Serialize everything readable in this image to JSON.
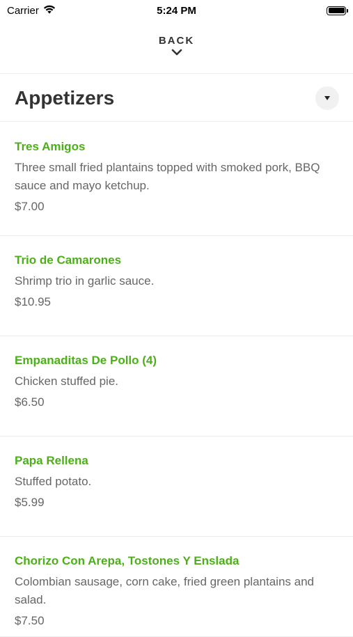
{
  "status_bar": {
    "carrier": "Carrier",
    "time": "5:24 PM",
    "battery_level": 1.0
  },
  "nav": {
    "back_label": "BACK"
  },
  "section": {
    "title": "Appetizers"
  },
  "menu_items": [
    {
      "name": "Tres Amigos",
      "description": "Three small fried plantains topped with smoked pork, BBQ sauce and mayo ketchup.",
      "price": "$7.00"
    },
    {
      "name": "Trio de Camarones",
      "description": "Shrimp trio in garlic sauce.",
      "price": "$10.95"
    },
    {
      "name": "Empanaditas De Pollo (4)",
      "description": "Chicken stuffed pie.",
      "price": "$6.50"
    },
    {
      "name": "Papa Rellena",
      "description": "Stuffed potato.",
      "price": "$5.99"
    },
    {
      "name": "Chorizo Con Arepa, Tostones Y Enslada",
      "description": "Colombian sausage, corn cake, fried green plantains and salad.",
      "price": "$7.50"
    }
  ],
  "colors": {
    "item_name": "#4caf1a",
    "text_secondary": "#666666",
    "divider": "#ececec"
  }
}
